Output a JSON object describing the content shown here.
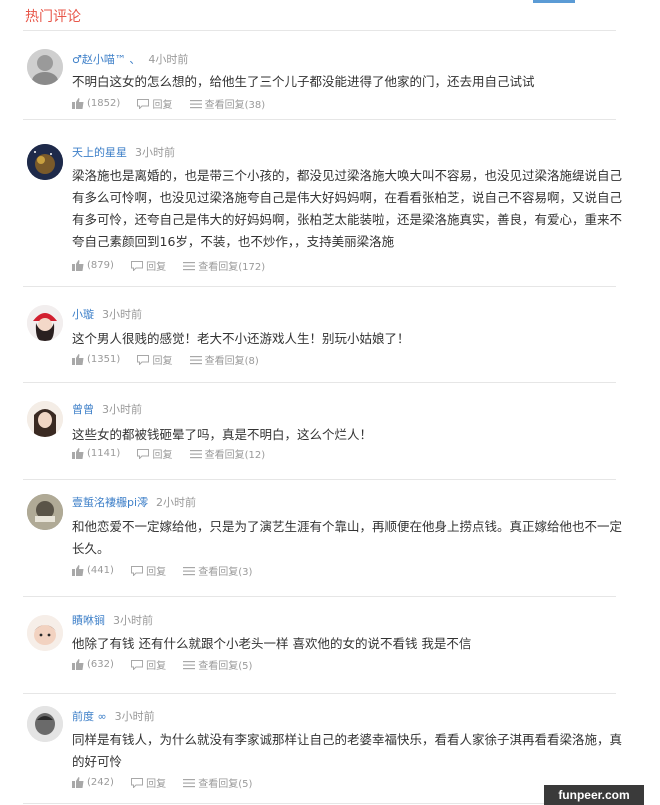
{
  "header": {
    "title": "热门评论"
  },
  "comments": [
    {
      "user": "♂赵小喵™ 、",
      "time": "4小时前",
      "text": "不明白这女的怎么想的，给他生了三个儿子都没能进得了他家的门，还去用自己试试",
      "likes": "(1852)",
      "reply_label": "回复",
      "view_replies_label": "查看回复(38)",
      "avatar_icon": "user-avatar"
    },
    {
      "user": "天上的星星",
      "time": "3小时前",
      "text": "梁洛施也是离婚的，也是带三个小孩的，都没见过梁洛施大唤大叫不容易，也没见过梁洛施缇说自己有多么可怜啊，也没见过梁洛施夸自己是伟大好妈妈啊，在看看张柏芝，说自己不容易啊，又说自己有多可怜，还夸自己是伟大的好妈妈啊，张柏芝太能装啦，还是梁洛施真实，善良，有爱心，重来不夸自己素颜回到16岁，不装，也不炒作，，支持美丽梁洛施",
      "likes": "(879)",
      "reply_label": "回复",
      "view_replies_label": "查看回复(172)",
      "avatar_icon": "user-avatar"
    },
    {
      "user": "小璇",
      "time": "3小时前",
      "text": "这个男人很贱的感觉！老大不小还游戏人生！别玩小姑娘了！",
      "likes": "(1351)",
      "reply_label": "回复",
      "view_replies_label": "查看回复(8)",
      "avatar_icon": "user-avatar"
    },
    {
      "user": "曾曾",
      "time": "3小时前",
      "text": "这些女的都被钱砸晕了吗，真是不明白，这么个烂人！",
      "likes": "(1141)",
      "reply_label": "回复",
      "view_replies_label": "查看回复(12)",
      "avatar_icon": "user-avatar"
    },
    {
      "user": "壹蜇洺褄棴pi澪",
      "time": "2小时前",
      "text": "和他恋爱不一定嫁给他，只是为了演艺生涯有个靠山，再顺便在他身上捞点钱。真正嫁给他也不一定长久。",
      "likes": "(441)",
      "reply_label": "回复",
      "view_replies_label": "查看回复(3)",
      "avatar_icon": "user-avatar"
    },
    {
      "user": "瞔咻锏",
      "time": "3小时前",
      "text": "他除了有钱 还有什么就跟个小老头一样 喜欢他的女的说不看钱 我是不信",
      "likes": "(632)",
      "reply_label": "回复",
      "view_replies_label": "查看回复(5)",
      "avatar_icon": "user-avatar"
    },
    {
      "user": "前度 ∞",
      "time": "3小时前",
      "text": "同样是有钱人，为什么就没有李家诚那样让自己的老婆幸福快乐，看看人家徐子淇再看看梁洛施，真的好可怜",
      "likes": "(242)",
      "reply_label": "回复",
      "view_replies_label": "查看回复(5)",
      "avatar_icon": "user-avatar"
    }
  ],
  "watermark": "funpeer.com"
}
